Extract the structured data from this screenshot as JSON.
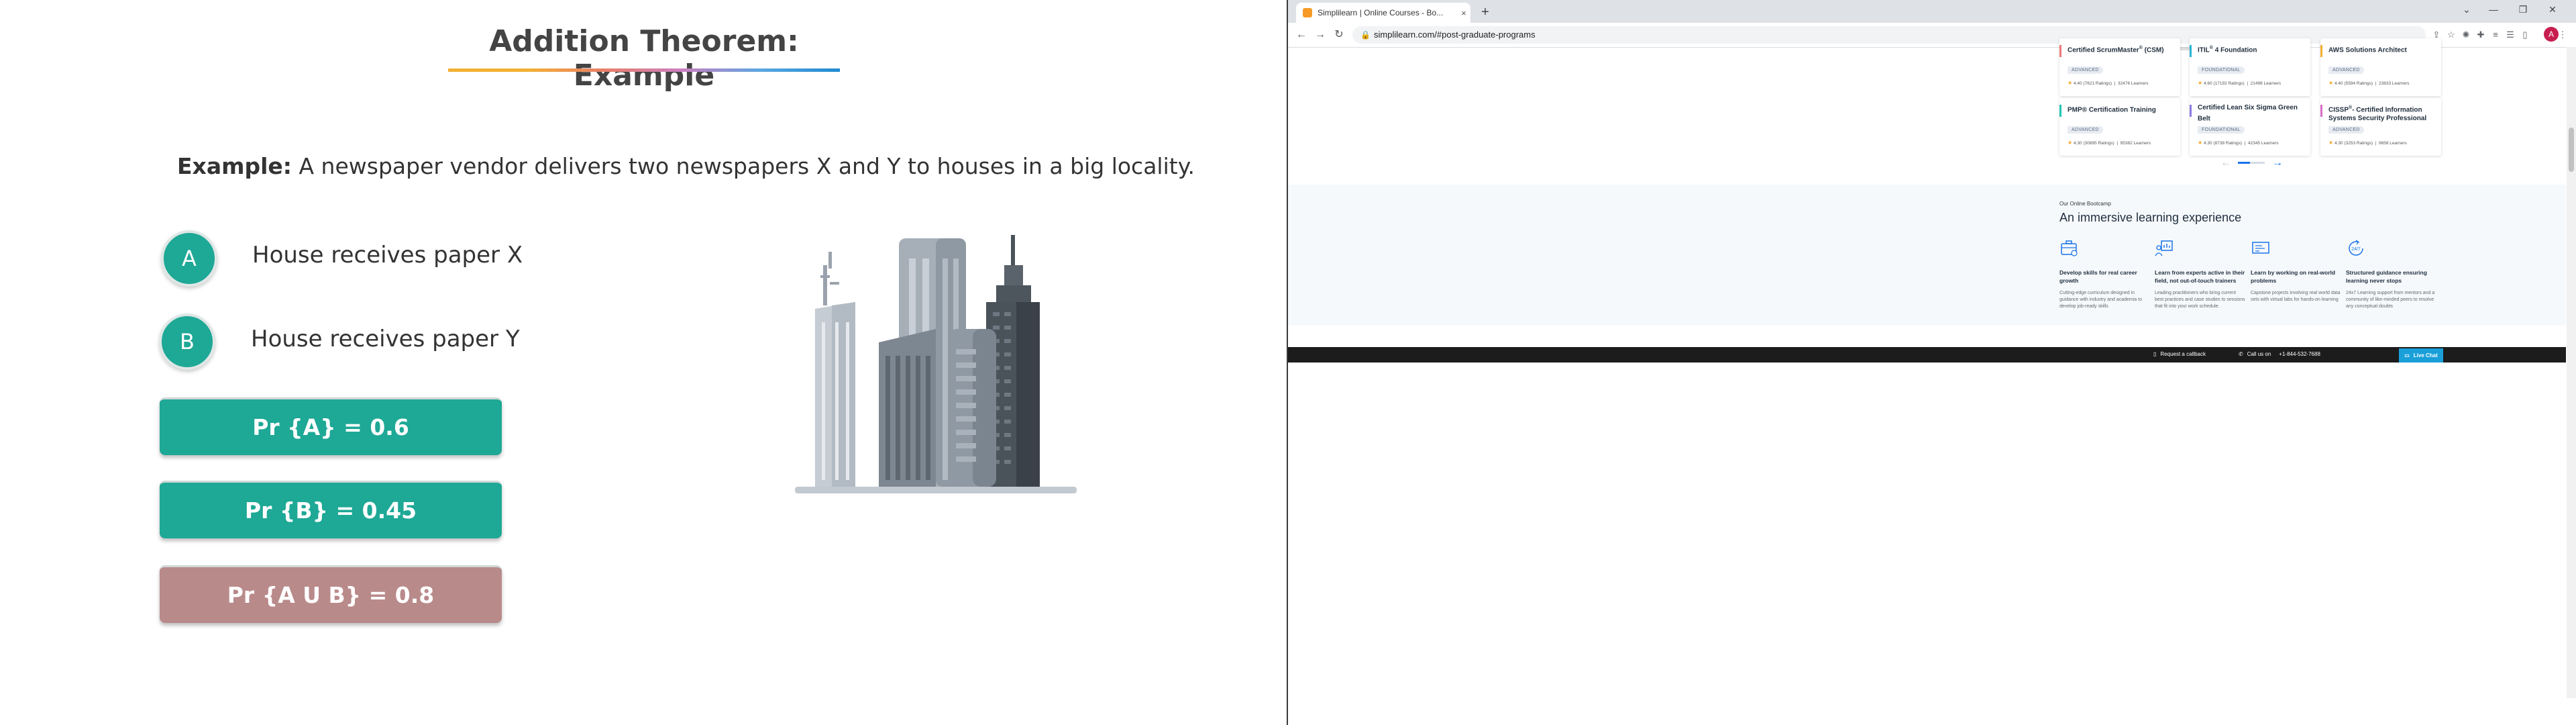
{
  "slide": {
    "title": "Addition Theorem: Example",
    "example_label": "Example:",
    "example_text": " A newspaper vendor delivers two newspapers X and Y to houses in a big locality.",
    "items": [
      {
        "letter": "A",
        "text": "House receives paper X"
      },
      {
        "letter": "B",
        "text": "House receives paper Y"
      }
    ],
    "probabilities": [
      {
        "text": "Pr {A} = 0.6",
        "color": "#1ea896"
      },
      {
        "text": "Pr {B} = 0.45",
        "color": "#1ea896"
      },
      {
        "text": "Pr {A U B} = 0.8",
        "color": "#b98a8a"
      }
    ],
    "illustration_icon": "city-buildings-icon"
  },
  "browser": {
    "tab_title": "Simplilearn | Online Courses - Bo...",
    "tab_close": "×",
    "new_tab": "+",
    "url": "simplilearn.com/#post-graduate-programs",
    "profile_initial": "A",
    "window_controls": [
      "⌄",
      "—",
      "❐",
      "✕"
    ]
  },
  "courses": [
    {
      "title": "Certified ScrumMaster",
      "sup": "®",
      "title_suffix": " (CSM)",
      "badge": "ADVANCED",
      "rating": "4.40 (7621 Ratings)",
      "learners": "32476 Learners",
      "accent": "#f07878"
    },
    {
      "title": "ITIL",
      "sup": "®",
      "title_suffix": " 4 Foundation",
      "badge": "FOUNDATIONAL",
      "rating": "4.60 (17192 Ratings)",
      "learners": "21498 Learners",
      "accent": "#2bb5d6"
    },
    {
      "title": "AWS Solutions Architect",
      "sup": "",
      "title_suffix": "",
      "badge": "ADVANCED",
      "rating": "4.40 (5594 Ratings)",
      "learners": "23833 Learners",
      "accent": "#f2b134"
    },
    {
      "title": "PMP® Certification Training",
      "sup": "",
      "title_suffix": "",
      "badge": "ADVANCED",
      "rating": "4.30 (30895 Ratings)",
      "learners": "95382 Learners",
      "accent": "#1ec6b4"
    },
    {
      "title": "Certified Lean Six Sigma Green Belt",
      "sup": "",
      "title_suffix": "",
      "badge": "FOUNDATIONAL",
      "rating": "4.30 (8738 Ratings)",
      "learners": "42345 Learners",
      "accent": "#8a7be0"
    },
    {
      "title": "CISSP",
      "sup": "®",
      "title_suffix": "- Certified Information Systems Security Professional",
      "badge": "ADVANCED",
      "rating": "4.30 (3253 Ratings)",
      "learners": "9658 Learners",
      "accent": "#d86fc8"
    }
  ],
  "bootcamp": {
    "eyebrow": "Our Online Bootcamp",
    "heading": "An immersive learning experience",
    "features": [
      {
        "icon": "briefcase-icon",
        "title": "Develop skills for real career growth",
        "desc": "Cutting-edge curriculum designed in guidance with industry and academia to develop job-ready skills"
      },
      {
        "icon": "presentation-board-icon",
        "title": "Learn from experts active in their field, not out-of-touch trainers",
        "desc": "Leading practitioners who bring current best practices and case studies to sessions that fit into your work schedule."
      },
      {
        "icon": "project-screen-icon",
        "title": "Learn by working on real-world problems",
        "desc": "Capstone projects involving real world data sets with virtual labs for hands-on learning"
      },
      {
        "icon": "24-7-support-icon",
        "title": "Structured guidance ensuring learning never stops",
        "desc": "24x7 Learning support from mentors and a community of like-minded peers to resolve any conceptual doubts"
      }
    ]
  },
  "footer": {
    "callback": "Request a callback",
    "call_label": "Call us on",
    "phone": "+1-844-532-7688",
    "live_chat": "Live Chat"
  }
}
